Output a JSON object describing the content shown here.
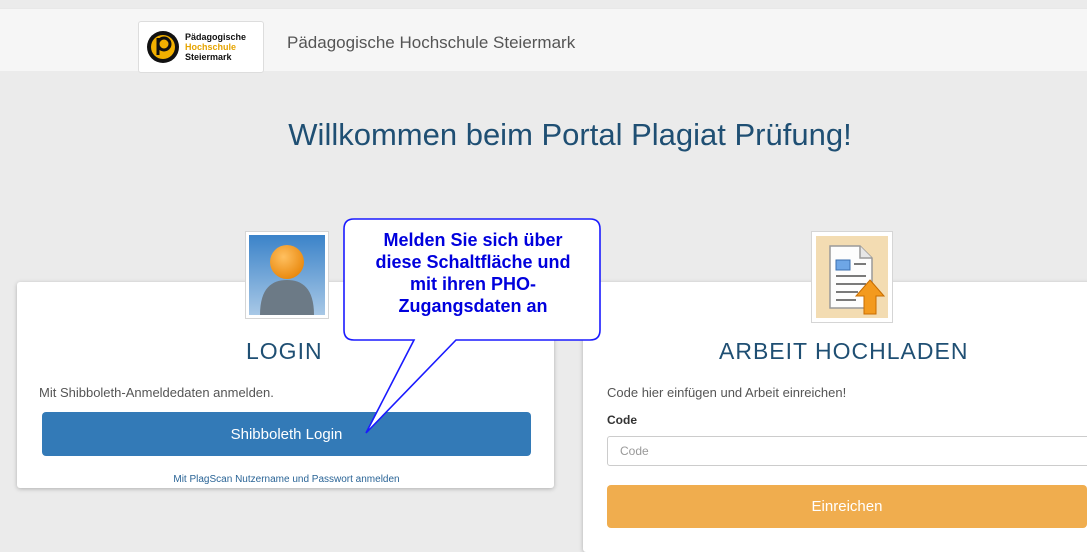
{
  "header": {
    "logo": {
      "line1": "Pädagogische",
      "line2": "Hochschule",
      "line3": "Steiermark"
    },
    "site_name": "Pädagogische Hochschule Steiermark"
  },
  "main": {
    "headline": "Willkommen beim Portal Plagiat Prüfung!"
  },
  "login_card": {
    "icon": "user-avatar-icon",
    "title": "LOGIN",
    "hint": "Mit Shibboleth-Anmeldedaten anmelden.",
    "shibboleth_button": "Shibboleth Login",
    "plagscan_link": "Mit PlagScan Nutzername und Passwort anmelden",
    "button_color": "#337ab7"
  },
  "upload_card": {
    "icon": "document-upload-icon",
    "title": "ARBEIT HOCHLADEN",
    "hint": "Code hier einfügen und Arbeit einreichen!",
    "code_label": "Code",
    "code_placeholder": "Code",
    "code_value": "",
    "submit_button": "Einreichen",
    "button_color": "#f0ad4e"
  },
  "callout": {
    "line1": "Melden Sie sich über",
    "line2": "diese Schaltfläche und",
    "line3": "mit ihren PHO-",
    "line4": "Zugangsdaten an"
  }
}
